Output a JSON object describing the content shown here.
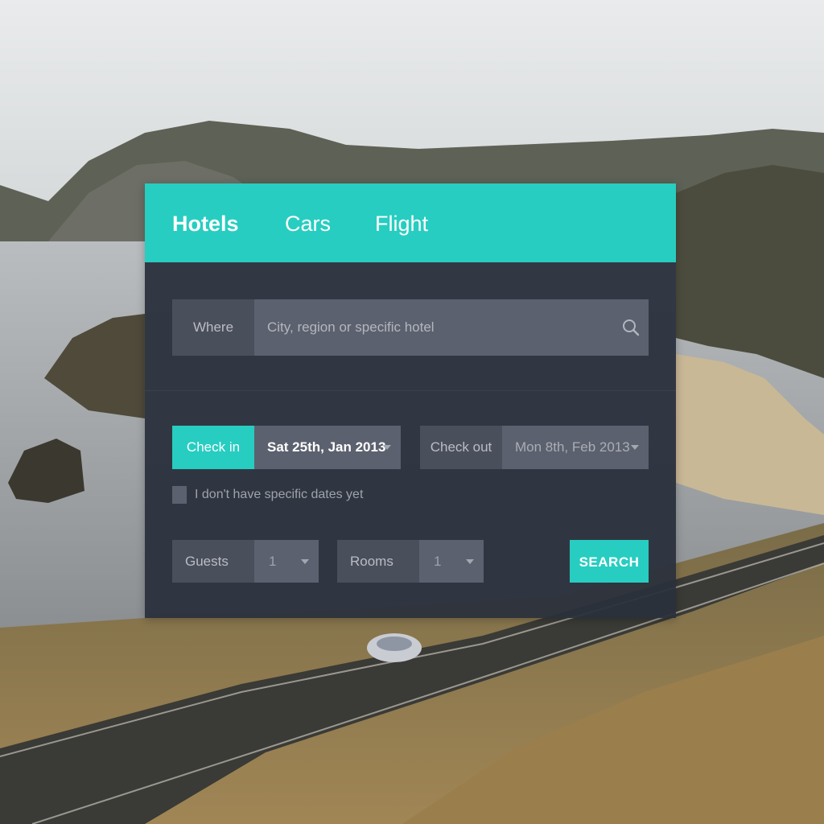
{
  "tabs": [
    {
      "label": "Hotels",
      "active": true
    },
    {
      "label": "Cars",
      "active": false
    },
    {
      "label": "Flight",
      "active": false
    }
  ],
  "where": {
    "label": "Where",
    "placeholder": "City, region or specific hotel",
    "value": ""
  },
  "check_in": {
    "label": "Check in",
    "value": "Sat 25th, Jan 2013"
  },
  "check_out": {
    "label": "Check out",
    "value": "Mon 8th, Feb 2013"
  },
  "no_dates": {
    "label": "I don't have specific dates yet",
    "checked": false
  },
  "guests": {
    "label": "Guests",
    "value": "1"
  },
  "rooms": {
    "label": "Rooms",
    "value": "1"
  },
  "search_button": {
    "label": "SEARCH"
  },
  "colors": {
    "accent": "#27cdc1",
    "panel": "#2a303c",
    "field_dark": "#4a4f5c",
    "field_light": "#5c616f"
  },
  "icons": {
    "search": "search-icon",
    "dropdown": "chevron-down-icon"
  }
}
